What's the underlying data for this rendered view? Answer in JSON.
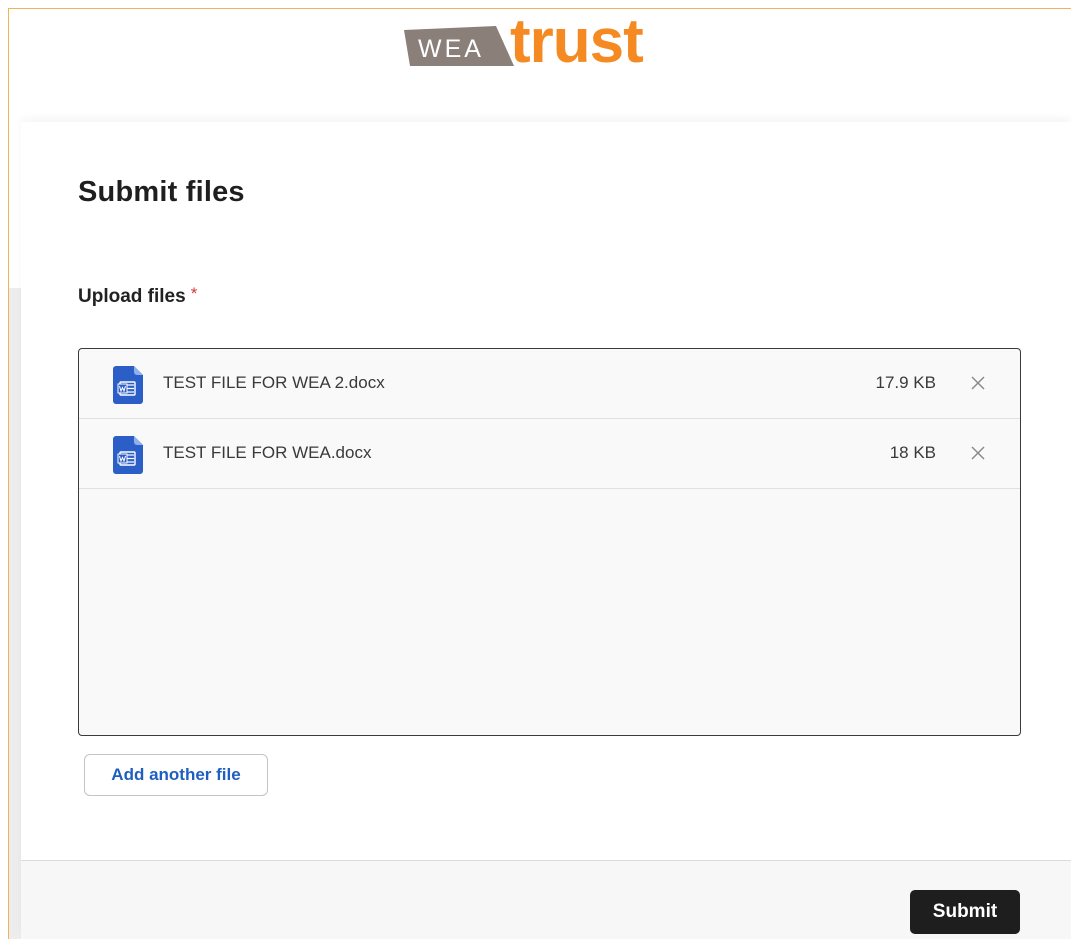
{
  "logo": {
    "wea": "WEA",
    "trust": "trust",
    "colors": {
      "wea_band": "#8a7f79",
      "trust": "#f58a23"
    }
  },
  "form": {
    "title": "Submit files",
    "upload_label": "Upload files",
    "required_marker": "*"
  },
  "files": [
    {
      "name": "TEST FILE FOR WEA 2.docx",
      "size": "17.9 KB",
      "icon": "word-doc-icon"
    },
    {
      "name": "TEST FILE FOR WEA.docx",
      "size": "18 KB",
      "icon": "word-doc-icon"
    }
  ],
  "buttons": {
    "add_file": "Add another file",
    "submit": "Submit"
  },
  "colors": {
    "accent_link": "#1e5fbf",
    "submit_bg": "#1e1e1e",
    "word_icon": "#2b5fc7",
    "required": "#d03a2f"
  }
}
